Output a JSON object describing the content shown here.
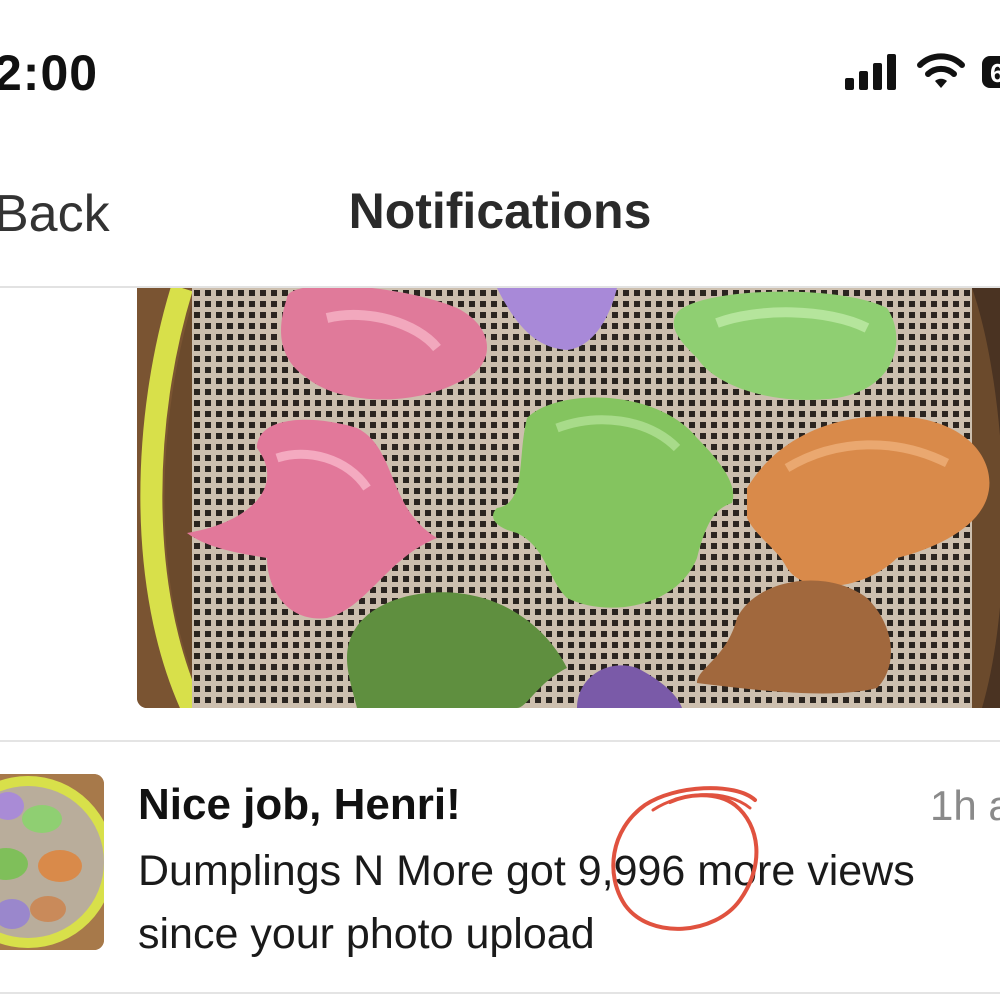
{
  "status_bar": {
    "time": "2:00",
    "icons": [
      "cellular-signal-icon",
      "wifi-icon",
      "battery-icon"
    ]
  },
  "nav": {
    "back_label": "Back",
    "title": "Notifications"
  },
  "hero_image": {
    "subject": "colorful dumplings in a steamer basket"
  },
  "notification": {
    "title": "Nice job, Henri!",
    "time": "1h a",
    "body_line1": "Dumplings N More got 9,996 more views",
    "body_line2": "since your photo upload",
    "highlighted_value": "9,996",
    "annotation_color": "#e0523f"
  }
}
